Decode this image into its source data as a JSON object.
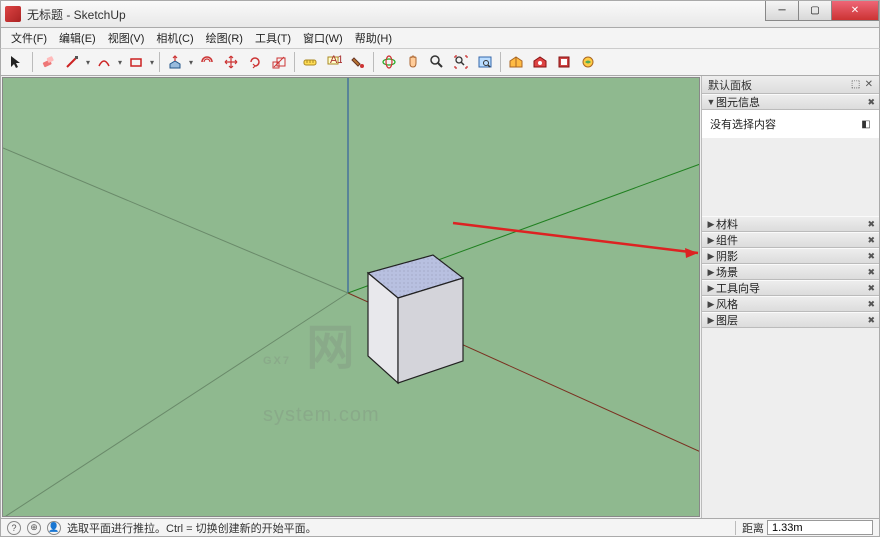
{
  "window": {
    "title": "无标题 - SketchUp"
  },
  "menu": {
    "items": [
      "文件(F)",
      "编辑(E)",
      "视图(V)",
      "相机(C)",
      "绘图(R)",
      "工具(T)",
      "窗口(W)",
      "帮助(H)"
    ]
  },
  "toolbar": {
    "groups": [
      [
        "select"
      ],
      [
        "eraser",
        "line",
        "line-dd",
        "arc",
        "arc-dd",
        "shape",
        "shape-dd"
      ],
      [
        "pushpull",
        "pushpull-dd",
        "offset",
        "move",
        "rotate",
        "scale"
      ],
      [
        "tape",
        "text",
        "paint"
      ],
      [
        "orbit",
        "pan",
        "zoom",
        "zoom-extents",
        "zoom-window"
      ],
      [
        "3dwarehouse",
        "extwarehouse",
        "layout",
        "addlocation"
      ]
    ]
  },
  "tray": {
    "title": "默认面板",
    "entity_info": {
      "label": "图元信息",
      "content": "没有选择内容"
    },
    "sections": [
      "材料",
      "组件",
      "阴影",
      "场景",
      "工具向导",
      "风格",
      "图层"
    ]
  },
  "status": {
    "hint": "选取平面进行推拉。Ctrl = 切换创建新的开始平面。",
    "measurement_label": "距离",
    "measurement_value": "1.33m"
  },
  "viewport": {
    "watermark_main": "GX7",
    "watermark_sub": "system.com"
  }
}
